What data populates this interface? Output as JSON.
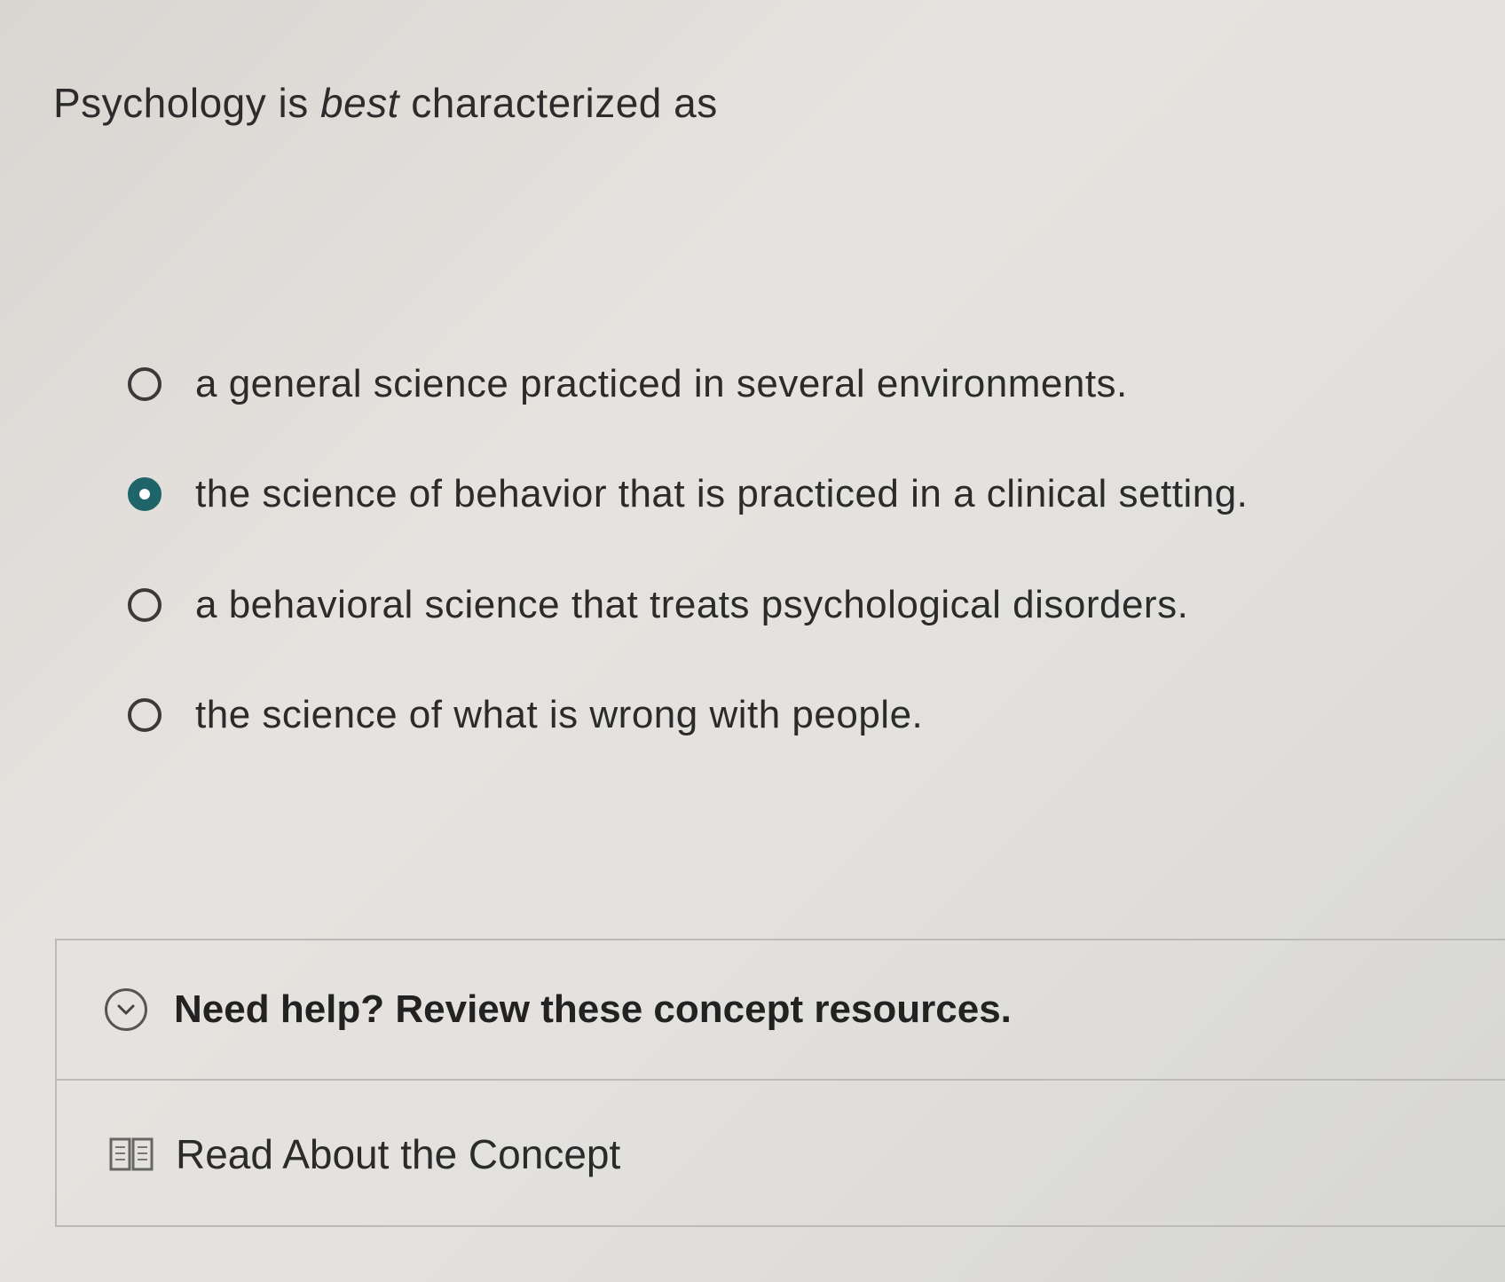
{
  "question": {
    "prompt_before": "Psychology is ",
    "prompt_emphasis": "best",
    "prompt_after": " characterized as"
  },
  "choices": [
    {
      "label": "a general science practiced in several environments.",
      "selected": false
    },
    {
      "label": "the science of behavior that is practiced in a clinical setting.",
      "selected": true
    },
    {
      "label": "a behavioral science that treats psychological disorders.",
      "selected": false
    },
    {
      "label": "the science of what is wrong with people.",
      "selected": false
    }
  ],
  "help": {
    "title": "Need help? Review these concept resources.",
    "toggle_icon": "chevron-down-circle-icon",
    "resources": [
      {
        "label": "Read About the Concept",
        "icon": "book-icon"
      }
    ]
  },
  "colors": {
    "selected_radio": "#1f6468",
    "text": "#2b2b2b",
    "divider": "#bdbbb8"
  }
}
